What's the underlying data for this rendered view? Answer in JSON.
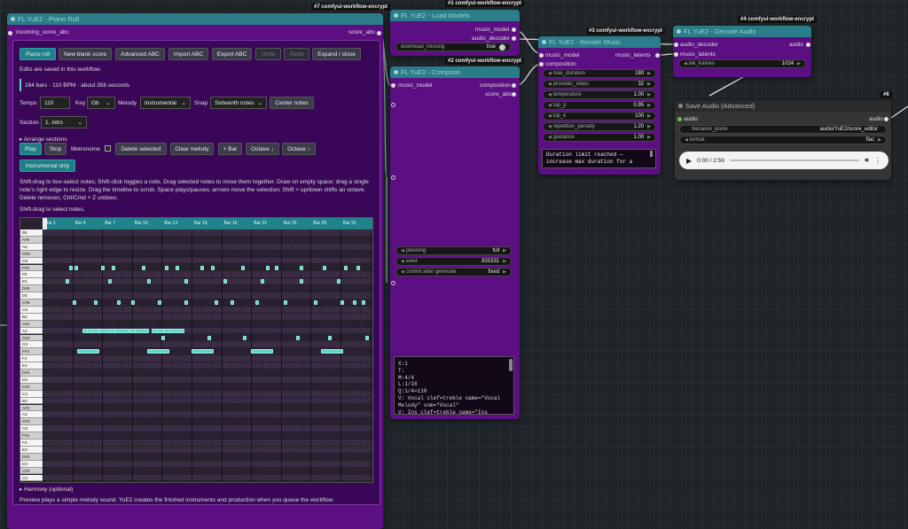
{
  "nodes": {
    "piano_roll": {
      "badge": "#7 comfyui-workflow-encrypt",
      "title": "FL YuE2 - Piano Roll",
      "input": "incoming_score_abc",
      "output": "score_abc",
      "buttons": {
        "piano_roll": "Piano roll",
        "new_blank": "New blank score",
        "advanced_abc": "Advanced ABC",
        "import_abc": "Import ABC",
        "export_abc": "Export ABC",
        "undo": "Undo",
        "redo": "Redo",
        "expand": "Expand / close"
      },
      "saved_note": "Edits are saved in this workflow.",
      "summary": "164 bars · 110 BPM · about 358 seconds",
      "tempo_label": "Tempo",
      "tempo_value": "110",
      "key_label": "Key",
      "key_value": "Gb",
      "melody_label": "Melody",
      "melody_value": "Instrumental",
      "snap_label": "Snap",
      "snap_value": "Sixteenth notes",
      "center_notes": "Center notes",
      "section_label": "Section",
      "section_value": "1. intro",
      "arrange": "▸ Arrange sections",
      "play": "Play",
      "stop": "Stop",
      "metronome": "Metronome",
      "delete_selected": "Delete selected",
      "clear_melody": "Clear melody",
      "plus_bar": "+ Bar",
      "octave_down": "Octave ↓",
      "octave_up": "Octave ↑",
      "instrumental_only": "Instrumental only",
      "help": "Shift-drag to box-select notes; Shift-click toggles a note. Drag selected notes to move them together. Draw on empty space; drag a single note's right edge to resize. Drag the timeline to scrub. Space plays/pauses; arrows move the selection; Shift + up/down shifts an octave. Delete removes; Ctrl/Cmd + Z undoes.",
      "shift_hint": "Shift-drag to select notes.",
      "bars": [
        "Bar 1",
        "Bar 4",
        "Bar 7",
        "Bar 10",
        "Bar 13",
        "Bar 16",
        "Bar 19",
        "Bar 22",
        "Bar 25",
        "Bar 28",
        "Bar 31"
      ],
      "keys": [
        "B5",
        "A#5",
        "A5",
        "G#5",
        "G5",
        "F#5",
        "F5",
        "E5",
        "D#5",
        "D5",
        "C#5",
        "C5",
        "B4",
        "A#4",
        "A4",
        "G#4",
        "G4",
        "F#4",
        "F4",
        "E4",
        "D#4",
        "D4",
        "C#4",
        "C4",
        "B3",
        "A#3",
        "A3",
        "G#3",
        "G3",
        "F#3",
        "F3",
        "E3",
        "D#3",
        "D3",
        "C#3",
        "C3"
      ],
      "harmony": "▸ Harmony (optional)",
      "footer": "Preview plays a simple melody sound. YuE2 creates the finished instruments and production when you queue the workflow."
    },
    "load_models": {
      "badge": "#1 comfyui-workflow-encrypt",
      "title": "FL YuE2 - Load Models",
      "outputs": [
        "music_model",
        "audio_decoder"
      ],
      "widget_label": "download_missing",
      "widget_value": "true"
    },
    "compose": {
      "badge": "#2 comfyui-workflow-encrypt",
      "title": "FL YuE2 - Compose",
      "input": "music_model",
      "outputs": [
        "composition",
        "score_abc"
      ],
      "widgets": [
        {
          "label": "planning",
          "value": "full"
        },
        {
          "label": "seed",
          "value": "831531"
        },
        {
          "label": "control after generate",
          "value": "fixed"
        }
      ],
      "abc_text": "X:1\nT:\nM:4/4\nL:1/16\nQ:1/4=110\nV: Vocal clef=treble name=\"Vocal\nMelody\" snm=\"Vocal\"\nV: Ins clef=treble name=\"Ins"
    },
    "render": {
      "badge": "#3 comfyui-workflow-encrypt",
      "title": "FL YuE2 - Render Music",
      "inputs": [
        "music_model",
        "composition"
      ],
      "output": "music_latents",
      "widgets": [
        {
          "label": "max_duration",
          "value": "180"
        },
        {
          "label": "prosodic_steps",
          "value": "32"
        },
        {
          "label": "temperature",
          "value": "1.00"
        },
        {
          "label": "top_p",
          "value": "0.95"
        },
        {
          "label": "top_k",
          "value": "100"
        },
        {
          "label": "repetition_penalty",
          "value": "1.20"
        },
        {
          "label": "guidance",
          "value": "1.00"
        }
      ],
      "status": "Duration limit reached —\nincrease max duration for a"
    },
    "decode": {
      "badge": "#4 comfyui-workflow-encrypt",
      "title": "FL YuE2 - Decode Audio",
      "inputs": [
        "audio_decoder",
        "music_latents"
      ],
      "output": "audio",
      "widget_label": "tile_frames",
      "widget_value": "1024"
    },
    "save_audio": {
      "badge": "#6",
      "title": "Save Audio (Advanced)",
      "input": "audio",
      "output": "audio",
      "widgets": [
        {
          "label": "filename_prefix",
          "value": "audio/YuE2/score_editor"
        },
        {
          "label": "format",
          "value": "flac"
        }
      ],
      "player_time": "0:00 / 2:59"
    }
  },
  "notes": [
    [
      16,
      14,
      2
    ],
    [
      18,
      14,
      2
    ],
    [
      20,
      14,
      2
    ],
    [
      22,
      14,
      2
    ],
    [
      23,
      14,
      2
    ],
    [
      27,
      14,
      2
    ],
    [
      29,
      14,
      2
    ],
    [
      35,
      14,
      2
    ],
    [
      37,
      14,
      2
    ],
    [
      44,
      14,
      2
    ],
    [
      46,
      14,
      2
    ],
    [
      49,
      14,
      2
    ],
    [
      51,
      14,
      2
    ],
    [
      14,
      17,
      3
    ],
    [
      42,
      17,
      3
    ],
    [
      60,
      17,
      3
    ],
    [
      84,
      17,
      3
    ],
    [
      112,
      17,
      3
    ],
    [
      134,
      17,
      3
    ],
    [
      156,
      17,
      2
    ],
    [
      174,
      17,
      2
    ],
    [
      200,
      17,
      2
    ],
    [
      226,
      17,
      2
    ],
    [
      256,
      17,
      3
    ],
    [
      278,
      17,
      2
    ],
    [
      300,
      17,
      2
    ],
    [
      318,
      17,
      2
    ],
    [
      344,
      17,
      2
    ]
  ]
}
